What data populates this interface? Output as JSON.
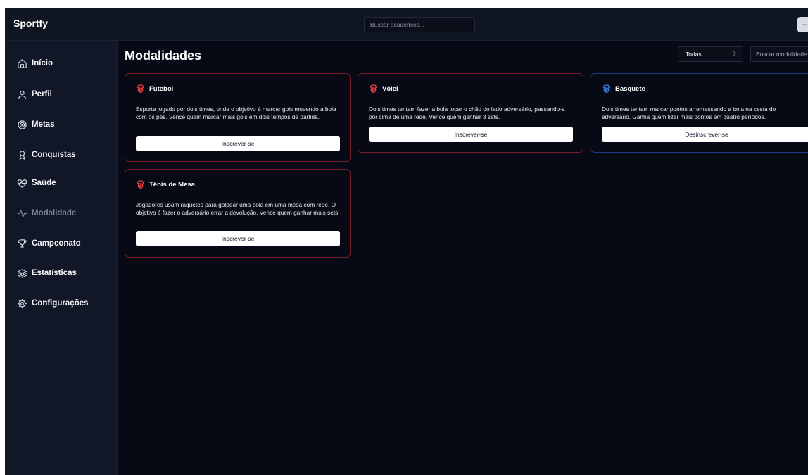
{
  "app": {
    "brand": "Sportfy",
    "avatar_text": "—"
  },
  "topbar": {
    "search_placeholder": "Buscar acadêmico..."
  },
  "sidebar": {
    "items": [
      {
        "label": "Início",
        "icon": "home-icon"
      },
      {
        "label": "Perfil",
        "icon": "user-icon"
      },
      {
        "label": "Metas",
        "icon": "target-icon"
      },
      {
        "label": "Conquistas",
        "icon": "award-icon"
      },
      {
        "label": "Saúde",
        "icon": "heart-pulse-icon"
      },
      {
        "label": "Modalidade",
        "icon": "activity-icon",
        "active": true
      },
      {
        "label": "Campeonato",
        "icon": "trophy-icon"
      },
      {
        "label": "Estatísticas",
        "icon": "layers-icon"
      },
      {
        "label": "Configurações",
        "icon": "gear-icon"
      }
    ]
  },
  "main": {
    "title": "Modalidades",
    "filter": {
      "selected": "Todas",
      "search_placeholder": "Buscar modalidade"
    },
    "cards": [
      {
        "title": "Futebol",
        "description": "Esporte jogado por dois times, onde o objetivo é marcar gols movendo a bola com os pés. Vence quem marcar mais gols em dois tempos de partida.",
        "button": "Inscrever-se",
        "enrolled": false
      },
      {
        "title": "Vôlei",
        "description": "Dois times tentam fazer a bola tocar o chão do lado adversário, passando-a por cima de uma rede. Vence quem ganhar 3 sets.",
        "button": "Inscrever-se",
        "enrolled": false
      },
      {
        "title": "Basquete",
        "description": "Dois times tentam marcar pontos arremessando a bola na cesta do adversário. Ganha quem fizer mais pontos em quatro períodos.",
        "button": "Desinscrever-se",
        "enrolled": true
      },
      {
        "title": "Tênis de Mesa",
        "description": "Jogadores usam raquetes para golpear uma bola em uma mesa com rede. O objetivo é fazer o adversário errar a devolução. Vence quem ganhar mais sets.",
        "button": "Inscrever-se",
        "enrolled": false
      }
    ]
  },
  "colors": {
    "background": "#070a15",
    "sidebar": "#111726",
    "card_border": "#7a1c24",
    "card_border_enrolled": "#233a8a",
    "icon_red": "#ef4444",
    "icon_blue": "#3b82f6"
  }
}
